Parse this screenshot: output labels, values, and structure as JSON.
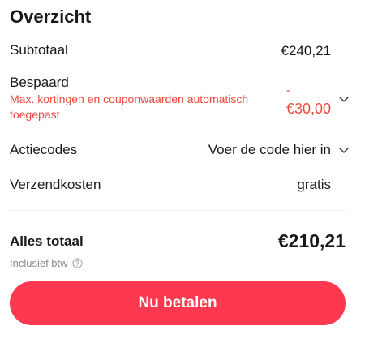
{
  "summary": {
    "title": "Overzicht",
    "subtotal": {
      "label": "Subtotaal",
      "value": "€240,21"
    },
    "saved": {
      "label": "Bespaard",
      "note": "Max. kortingen en couponwaarden automatisch toegepast",
      "sign": "-",
      "value": "€30,00"
    },
    "promo": {
      "label": "Actiecodes",
      "placeholder": "Voer de code hier in"
    },
    "shipping": {
      "label": "Verzendkosten",
      "value": "gratis"
    },
    "total": {
      "label": "Alles totaal",
      "value": "€210,21",
      "vat_note": "Inclusief btw"
    },
    "pay_button": "Nu betalen"
  },
  "colors": {
    "accent": "#fd384f",
    "discount": "#ea4a3c",
    "muted": "#888888"
  },
  "icons": [
    "chevron-down-icon",
    "help-circle-icon"
  ]
}
